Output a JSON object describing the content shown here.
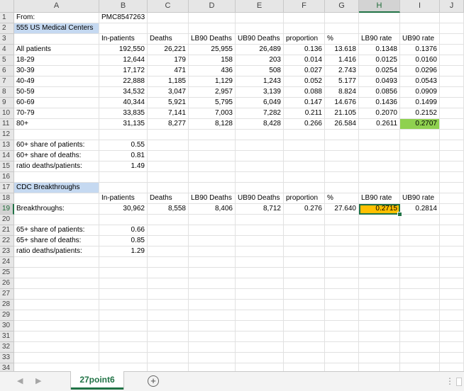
{
  "columns": [
    "A",
    "B",
    "C",
    "D",
    "E",
    "F",
    "G",
    "H",
    "I",
    "J"
  ],
  "active_col": "H",
  "active_row": 19,
  "row_count": 34,
  "cells": {
    "A1": "From:",
    "B1": "PMC8547263",
    "A2": "555 US Medical Centers",
    "B3": "In-patients",
    "C3": "Deaths",
    "D3": "LB90 Deaths",
    "E3": "UB90 Deaths",
    "F3": "proportion",
    "G3": "%",
    "H3": "LB90 rate",
    "I3": "UB90 rate",
    "A4": "All patients",
    "B4": "192,550",
    "C4": "26,221",
    "D4": "25,955",
    "E4": "26,489",
    "F4": "0.136",
    "G4": "13.618",
    "H4": "0.1348",
    "I4": "0.1376",
    "A5": "18-29",
    "B5": "12,644",
    "C5": "179",
    "D5": "158",
    "E5": "203",
    "F5": "0.014",
    "G5": "1.416",
    "H5": "0.0125",
    "I5": "0.0160",
    "A6": "30-39",
    "B6": "17,172",
    "C6": "471",
    "D6": "436",
    "E6": "508",
    "F6": "0.027",
    "G6": "2.743",
    "H6": "0.0254",
    "I6": "0.0296",
    "A7": "40-49",
    "B7": "22,888",
    "C7": "1,185",
    "D7": "1,129",
    "E7": "1,243",
    "F7": "0.052",
    "G7": "5.177",
    "H7": "0.0493",
    "I7": "0.0543",
    "A8": "50-59",
    "B8": "34,532",
    "C8": "3,047",
    "D8": "2,957",
    "E8": "3,139",
    "F8": "0.088",
    "G8": "8.824",
    "H8": "0.0856",
    "I8": "0.0909",
    "A9": "60-69",
    "B9": "40,344",
    "C9": "5,921",
    "D9": "5,795",
    "E9": "6,049",
    "F9": "0.147",
    "G9": "14.676",
    "H9": "0.1436",
    "I9": "0.1499",
    "A10": "70-79",
    "B10": "33,835",
    "C10": "7,141",
    "D10": "7,003",
    "E10": "7,282",
    "F10": "0.211",
    "G10": "21.105",
    "H10": "0.2070",
    "I10": "0.2152",
    "A11": "80+",
    "B11": "31,135",
    "C11": "8,277",
    "D11": "8,128",
    "E11": "8,428",
    "F11": "0.266",
    "G11": "26.584",
    "H11": "0.2611",
    "I11": "0.2707",
    "A13": "60+ share of patients:",
    "B13": "0.55",
    "A14": "60+ share of deaths:",
    "B14": "0.81",
    "A15": "ratio deaths/patients:",
    "B15": "1.49",
    "A17": "CDC Breakthroughs",
    "B18": "In-patients",
    "C18": "Deaths",
    "D18": "LB90 Deaths",
    "E18": "UB90 Deaths",
    "F18": "proportion",
    "G18": "%",
    "H18": "LB90 rate",
    "I18": "UB90 rate",
    "A19": "Breakthroughs:",
    "B19": "30,962",
    "C19": "8,558",
    "D19": "8,406",
    "E19": "8,712",
    "F19": "0.276",
    "G19": "27.640",
    "H19": "0.2715",
    "I19": "0.2814",
    "A21": "65+ share of patients:",
    "B21": "0.66",
    "A22": "65+ share of deaths:",
    "B22": "0.85",
    "A23": "ratio deaths/patients:",
    "B23": "1.29"
  },
  "cell_styles": {
    "A2": "lbl-blue",
    "A17": "lbl-blue",
    "I11": "fill-green",
    "H19": "fill-orange"
  },
  "left_aligned_cells": [
    "A1",
    "B1",
    "A2",
    "B3",
    "C3",
    "D3",
    "E3",
    "F3",
    "G3",
    "H3",
    "I3",
    "A17",
    "B18",
    "C18",
    "D18",
    "E18",
    "F18",
    "G18",
    "H18",
    "I18",
    "A4",
    "A5",
    "A6",
    "A7",
    "A8",
    "A9",
    "A10",
    "A11",
    "A13",
    "A14",
    "A15",
    "A19",
    "A21",
    "A22",
    "A23"
  ],
  "sheet_tab": {
    "label": "27point6"
  },
  "tabbar": {
    "add_icon": "⊕",
    "prev_icon": "◀",
    "next_icon": "▶",
    "more_icon": "⋮"
  }
}
